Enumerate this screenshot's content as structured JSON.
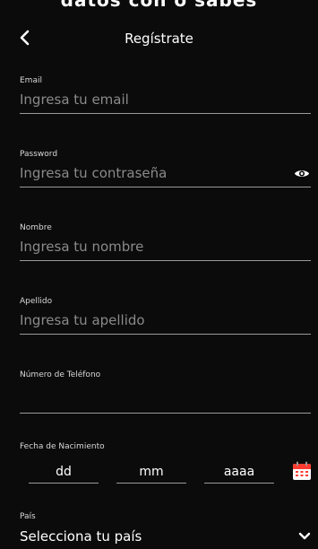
{
  "top_cutoff_text": "datos con o sabes",
  "header": {
    "title": "Regístrate"
  },
  "fields": {
    "email": {
      "label": "Email",
      "placeholder": "Ingresa tu email",
      "value": ""
    },
    "password": {
      "label": "Password",
      "placeholder": "Ingresa tu contraseña",
      "value": ""
    },
    "nombre": {
      "label": "Nombre",
      "placeholder": "Ingresa tu nombre",
      "value": ""
    },
    "apellido": {
      "label": "Apellido",
      "placeholder": "Ingresa tu apellido",
      "value": ""
    },
    "telefono": {
      "label": "Número de Teléfono",
      "placeholder": "",
      "value": ""
    }
  },
  "birthdate": {
    "label": "Fecha de Nacimiento",
    "day_placeholder": "dd",
    "month_placeholder": "mm",
    "year_placeholder": "aaaa"
  },
  "country": {
    "label": "País",
    "selected": "Selecciona tu país"
  },
  "icons": {
    "back": "chevron-left-icon",
    "password_toggle": "eye-icon",
    "date_picker": "calendar-icon",
    "country_dropdown": "chevron-down-icon"
  },
  "colors": {
    "background": "#0b0b0b",
    "text": "#ffffff",
    "placeholder": "#8a8a8a",
    "divider": "#9a9a9a",
    "calendar": "#ff3b30"
  }
}
